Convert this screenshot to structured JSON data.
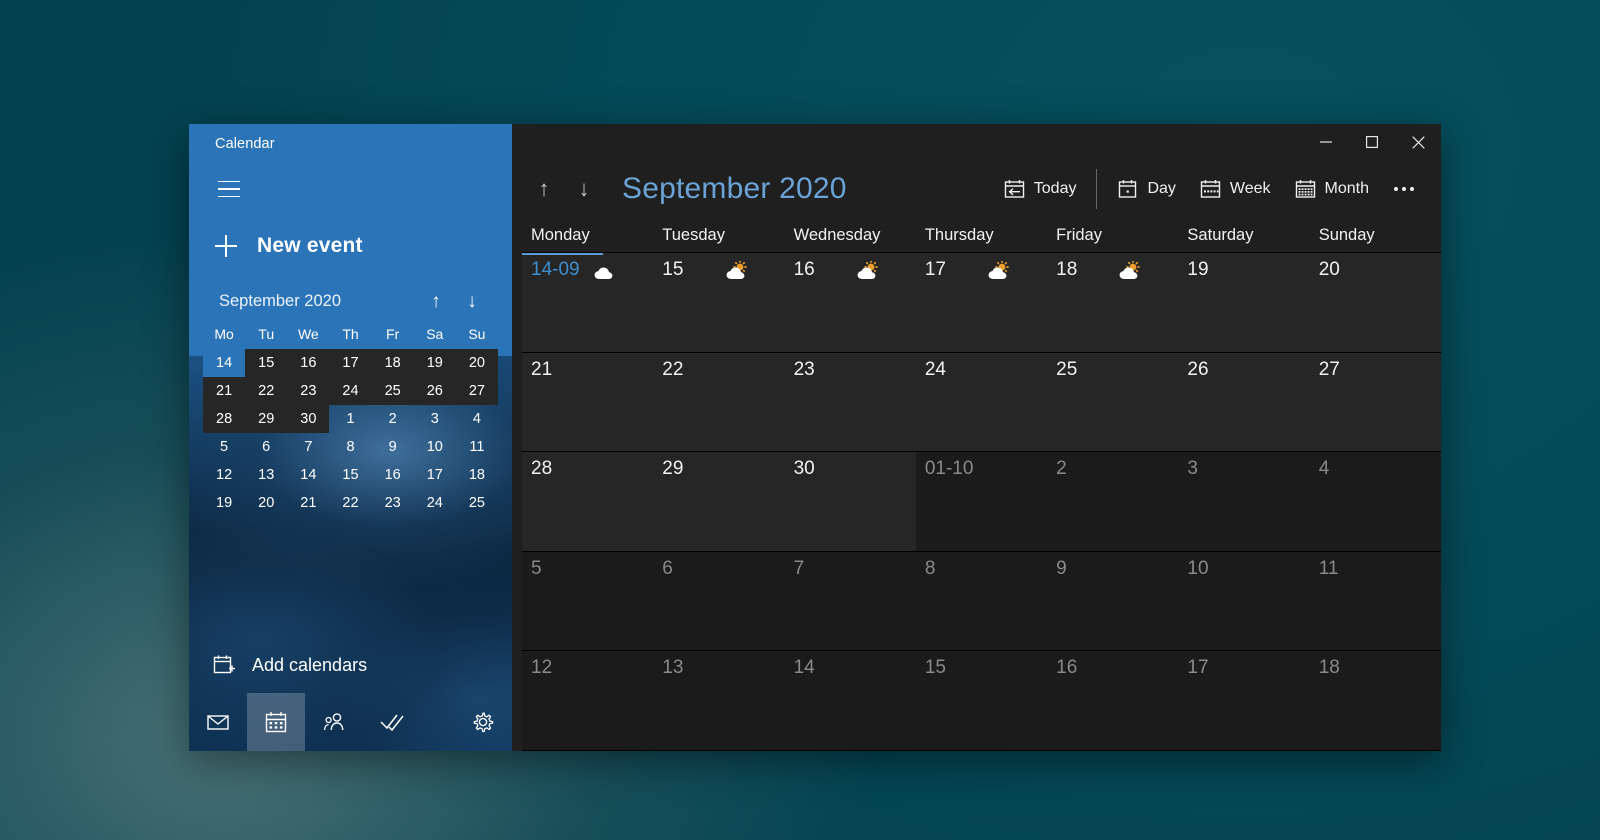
{
  "desktop": {
    "accent_blue": "#2b74b8",
    "background_teal": "#04535f"
  },
  "window": {
    "title": "Calendar",
    "controls": {
      "minimize": {
        "name": "minimize-button",
        "glyph": "–"
      },
      "maximize": {
        "name": "maximize-button",
        "glyph": "□"
      },
      "close": {
        "name": "close-button",
        "glyph": "✕"
      }
    }
  },
  "nav_pane": {
    "title": "Calendar",
    "hamburger_label": "Menu",
    "new_event_label": "New event",
    "mini_calendar": {
      "month_label": "September 2020",
      "prev_arrow": "↑",
      "next_arrow": "↓",
      "weekdays": [
        "Mo",
        "Tu",
        "We",
        "Th",
        "Fr",
        "Sa",
        "Su"
      ],
      "weeks": [
        [
          {
            "n": "14",
            "state": "selected"
          },
          {
            "n": "15",
            "state": "current"
          },
          {
            "n": "16",
            "state": "current"
          },
          {
            "n": "17",
            "state": "current"
          },
          {
            "n": "18",
            "state": "current"
          },
          {
            "n": "19",
            "state": "current"
          },
          {
            "n": "20",
            "state": "current"
          }
        ],
        [
          {
            "n": "21",
            "state": "current"
          },
          {
            "n": "22",
            "state": "current"
          },
          {
            "n": "23",
            "state": "current"
          },
          {
            "n": "24",
            "state": "current"
          },
          {
            "n": "25",
            "state": "current"
          },
          {
            "n": "26",
            "state": "current"
          },
          {
            "n": "27",
            "state": "current"
          }
        ],
        [
          {
            "n": "28",
            "state": "current"
          },
          {
            "n": "29",
            "state": "current"
          },
          {
            "n": "30",
            "state": "current"
          },
          {
            "n": "1",
            "state": "next"
          },
          {
            "n": "2",
            "state": "next"
          },
          {
            "n": "3",
            "state": "next"
          },
          {
            "n": "4",
            "state": "next"
          }
        ],
        [
          {
            "n": "5",
            "state": "next"
          },
          {
            "n": "6",
            "state": "next"
          },
          {
            "n": "7",
            "state": "next"
          },
          {
            "n": "8",
            "state": "next"
          },
          {
            "n": "9",
            "state": "next"
          },
          {
            "n": "10",
            "state": "next"
          },
          {
            "n": "11",
            "state": "next"
          }
        ],
        [
          {
            "n": "12",
            "state": "next"
          },
          {
            "n": "13",
            "state": "next"
          },
          {
            "n": "14",
            "state": "next"
          },
          {
            "n": "15",
            "state": "next"
          },
          {
            "n": "16",
            "state": "next"
          },
          {
            "n": "17",
            "state": "next"
          },
          {
            "n": "18",
            "state": "next"
          }
        ],
        [
          {
            "n": "19",
            "state": "next"
          },
          {
            "n": "20",
            "state": "next"
          },
          {
            "n": "21",
            "state": "next"
          },
          {
            "n": "22",
            "state": "next"
          },
          {
            "n": "23",
            "state": "next"
          },
          {
            "n": "24",
            "state": "next"
          },
          {
            "n": "25",
            "state": "next"
          }
        ]
      ]
    },
    "add_calendars_label": "Add calendars",
    "tabs": [
      {
        "name": "mail",
        "icon": "mail-icon",
        "active": false
      },
      {
        "name": "calendar",
        "icon": "calendar-icon",
        "active": true
      },
      {
        "name": "people",
        "icon": "people-icon",
        "active": false
      },
      {
        "name": "todo",
        "icon": "checkmark-icon",
        "active": false
      },
      {
        "name": "settings",
        "icon": "gear-icon",
        "active": false
      }
    ]
  },
  "toolbar": {
    "prev_arrow": "↑",
    "next_arrow": "↓",
    "month_title": "September 2020",
    "today_label": "Today",
    "day_label": "Day",
    "week_label": "Week",
    "month_label": "Month",
    "more_label": "More options"
  },
  "month_view": {
    "weekday_headers": [
      "Monday",
      "Tuesday",
      "Wednesday",
      "Thursday",
      "Friday",
      "Saturday",
      "Sunday"
    ],
    "weeks": [
      [
        {
          "label": "14-09",
          "state": "today",
          "weather": "cloudy"
        },
        {
          "label": "15",
          "state": "current",
          "weather": "partly-sunny"
        },
        {
          "label": "16",
          "state": "current",
          "weather": "partly-sunny"
        },
        {
          "label": "17",
          "state": "current",
          "weather": "partly-sunny"
        },
        {
          "label": "18",
          "state": "current",
          "weather": "partly-sunny"
        },
        {
          "label": "19",
          "state": "current",
          "weather": null
        },
        {
          "label": "20",
          "state": "current",
          "weather": null
        }
      ],
      [
        {
          "label": "21",
          "state": "current",
          "weather": null
        },
        {
          "label": "22",
          "state": "current",
          "weather": null
        },
        {
          "label": "23",
          "state": "current",
          "weather": null
        },
        {
          "label": "24",
          "state": "current",
          "weather": null
        },
        {
          "label": "25",
          "state": "current",
          "weather": null
        },
        {
          "label": "26",
          "state": "current",
          "weather": null
        },
        {
          "label": "27",
          "state": "current",
          "weather": null
        }
      ],
      [
        {
          "label": "28",
          "state": "current",
          "weather": null
        },
        {
          "label": "29",
          "state": "current",
          "weather": null
        },
        {
          "label": "30",
          "state": "current",
          "weather": null
        },
        {
          "label": "01-10",
          "state": "out",
          "weather": null
        },
        {
          "label": "2",
          "state": "out",
          "weather": null
        },
        {
          "label": "3",
          "state": "out",
          "weather": null
        },
        {
          "label": "4",
          "state": "out",
          "weather": null
        }
      ],
      [
        {
          "label": "5",
          "state": "out",
          "weather": null
        },
        {
          "label": "6",
          "state": "out",
          "weather": null
        },
        {
          "label": "7",
          "state": "out",
          "weather": null
        },
        {
          "label": "8",
          "state": "out",
          "weather": null
        },
        {
          "label": "9",
          "state": "out",
          "weather": null
        },
        {
          "label": "10",
          "state": "out",
          "weather": null
        },
        {
          "label": "11",
          "state": "out",
          "weather": null
        }
      ],
      [
        {
          "label": "12",
          "state": "out",
          "weather": null
        },
        {
          "label": "13",
          "state": "out",
          "weather": null
        },
        {
          "label": "14",
          "state": "out",
          "weather": null
        },
        {
          "label": "15",
          "state": "out",
          "weather": null
        },
        {
          "label": "16",
          "state": "out",
          "weather": null
        },
        {
          "label": "17",
          "state": "out",
          "weather": null
        },
        {
          "label": "18",
          "state": "out",
          "weather": null
        }
      ]
    ]
  }
}
